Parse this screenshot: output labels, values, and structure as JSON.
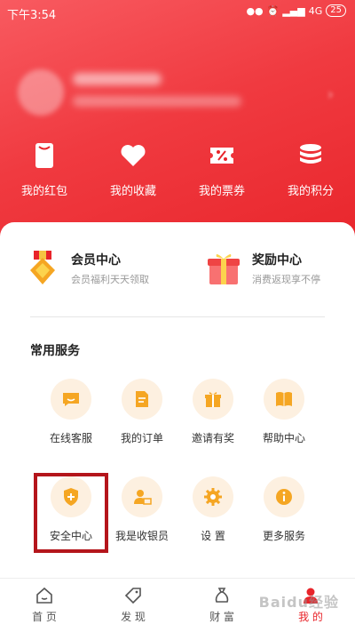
{
  "status_bar": {
    "time": "下午3:54",
    "signal": "4G",
    "battery": "25"
  },
  "quick_actions": [
    {
      "label": "我的红包",
      "icon": "red-packet-icon"
    },
    {
      "label": "我的收藏",
      "icon": "heart-icon"
    },
    {
      "label": "我的票券",
      "icon": "coupon-icon"
    },
    {
      "label": "我的积分",
      "icon": "coins-icon"
    }
  ],
  "centers": {
    "member": {
      "title": "会员中心",
      "subtitle": "会员福利天天领取",
      "icon": "medal-icon"
    },
    "reward": {
      "title": "奖励中心",
      "subtitle": "消费返现享不停",
      "icon": "gift-box-icon"
    }
  },
  "services": {
    "title": "常用服务",
    "items": [
      {
        "label": "在线客服",
        "icon": "chat-icon"
      },
      {
        "label": "我的订单",
        "icon": "order-icon"
      },
      {
        "label": "邀请有奖",
        "icon": "gift-icon"
      },
      {
        "label": "帮助中心",
        "icon": "book-icon"
      },
      {
        "label": "安全中心",
        "icon": "shield-icon"
      },
      {
        "label": "我是收银员",
        "icon": "cashier-icon"
      },
      {
        "label": "设 置",
        "icon": "gear-icon"
      },
      {
        "label": "更多服务",
        "icon": "info-icon"
      }
    ]
  },
  "tabs": [
    {
      "label": "首 页",
      "icon": "home-icon",
      "active": false
    },
    {
      "label": "发 现",
      "icon": "tag-icon",
      "active": false
    },
    {
      "label": "财 富",
      "icon": "money-bag-icon",
      "active": false
    },
    {
      "label": "我 的",
      "icon": "user-icon",
      "active": true
    }
  ],
  "watermark": "Baidu经验",
  "colors": {
    "brand": "#e8242a",
    "icon_bg": "#fdf0e0",
    "icon_accent": "#f5a623",
    "highlight": "#b4151b"
  }
}
